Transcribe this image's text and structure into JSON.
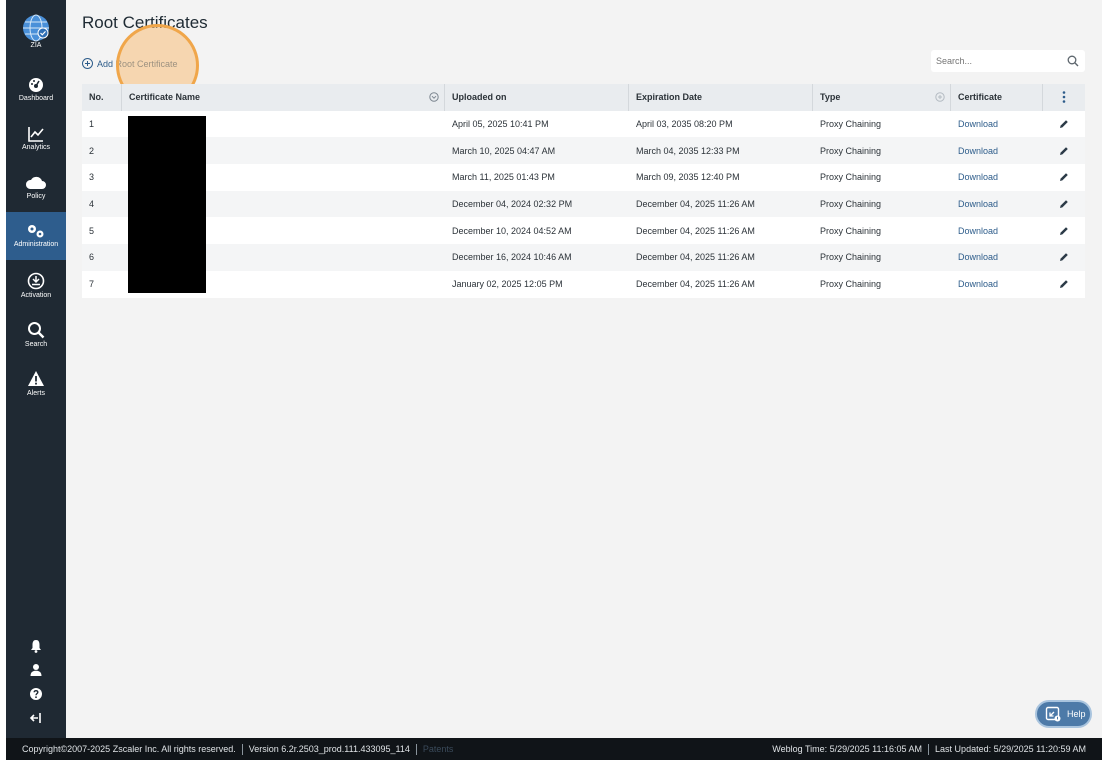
{
  "app": {
    "logo_label": "ZIA",
    "nav": [
      {
        "label": "Dashboard",
        "icon": "dashboard-icon",
        "active": false
      },
      {
        "label": "Analytics",
        "icon": "analytics-icon",
        "active": false
      },
      {
        "label": "Policy",
        "icon": "cloud-icon",
        "active": false
      },
      {
        "label": "Administration",
        "icon": "gears-icon",
        "active": true
      },
      {
        "label": "Activation",
        "icon": "activation-icon",
        "active": false
      },
      {
        "label": "Search",
        "icon": "search-icon",
        "active": false
      },
      {
        "label": "Alerts",
        "icon": "alert-icon",
        "active": false
      }
    ],
    "bottom_icons": [
      "bell-icon",
      "user-icon",
      "question-icon",
      "logout-icon"
    ]
  },
  "page": {
    "title": "Root Certificates",
    "add_label": "Add Root Certificate",
    "search_placeholder": "Search..."
  },
  "table": {
    "headers": {
      "no": "No.",
      "name": "Certificate Name",
      "uploaded": "Uploaded on",
      "expiration": "Expiration Date",
      "type": "Type",
      "certificate": "Certificate"
    },
    "rows": [
      {
        "no": "1",
        "uploaded": "April 05, 2025 10:41 PM",
        "expiration": "April 03, 2035 08:20 PM",
        "type": "Proxy Chaining",
        "certificate": "Download"
      },
      {
        "no": "2",
        "uploaded": "March 10, 2025 04:47 AM",
        "expiration": "March 04, 2035 12:33 PM",
        "type": "Proxy Chaining",
        "certificate": "Download"
      },
      {
        "no": "3",
        "uploaded": "March 11, 2025 01:43 PM",
        "expiration": "March 09, 2035 12:40 PM",
        "type": "Proxy Chaining",
        "certificate": "Download"
      },
      {
        "no": "4",
        "uploaded": "December 04, 2024 02:32 PM",
        "expiration": "December 04, 2025 11:26 AM",
        "type": "Proxy Chaining",
        "certificate": "Download"
      },
      {
        "no": "5",
        "uploaded": "December 10, 2024 04:52 AM",
        "expiration": "December 04, 2025 11:26 AM",
        "type": "Proxy Chaining",
        "certificate": "Download"
      },
      {
        "no": "6",
        "uploaded": "December 16, 2024 10:46 AM",
        "expiration": "December 04, 2025 11:26 AM",
        "type": "Proxy Chaining",
        "certificate": "Download"
      },
      {
        "no": "7",
        "uploaded": "January 02, 2025 12:05 PM",
        "expiration": "December 04, 2025 11:26 AM",
        "type": "Proxy Chaining",
        "certificate": "Download"
      }
    ]
  },
  "help": {
    "label": "Help"
  },
  "footer": {
    "copyright": "Copyright©2007-2025 Zscaler Inc. All rights reserved.",
    "version": "Version 6.2r.2503_prod.111.433095_114",
    "patents": "Patents",
    "weblog_time": "Weblog Time: 5/29/2025 11:16:05 AM",
    "last_updated": "Last Updated: 5/29/2025 11:20:59 AM"
  },
  "colors": {
    "sidebar": "#1f2933",
    "active_nav": "#2e5d8d",
    "link": "#2d5c8a",
    "main_bg": "#f3f3f3",
    "click_highlight": "#f0a64a"
  }
}
